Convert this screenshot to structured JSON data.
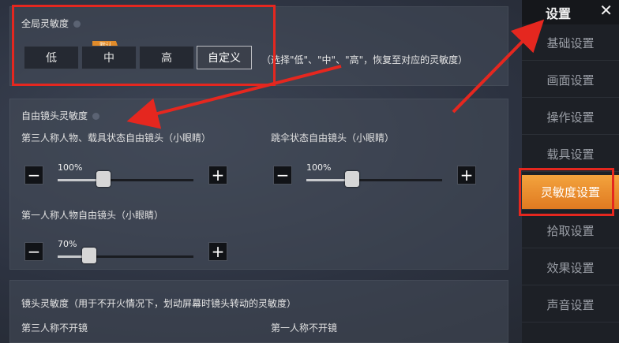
{
  "global_sensitivity": {
    "title": "全局灵敏度",
    "options": [
      "低",
      "中",
      "高",
      "自定义"
    ],
    "default_badge": "默认",
    "note": "（选择\"低\"、\"中\"、\"高\"，恢复至对应的灵敏度）"
  },
  "free_camera": {
    "title": "自由镜头灵敏度",
    "sliders": [
      {
        "label": "第三人称人物、载具状态自由镜头（小眼睛）",
        "value_text": "100%",
        "level": 0.34
      },
      {
        "label": "跳伞状态自由镜头（小眼睛）",
        "value_text": "100%",
        "level": 0.34
      },
      {
        "label": "第一人称人物自由镜头（小眼睛）",
        "value_text": "70%",
        "level": 0.23
      }
    ]
  },
  "camera_sensitivity": {
    "title": "镜头灵敏度（用于不开火情况下，划动屏幕时镜头转动的灵敏度）",
    "col1": "第三人称不开镜",
    "col2": "第一人称不开镜"
  },
  "sidebar": {
    "title": "设置",
    "close": "✕",
    "items": [
      "基础设置",
      "画面设置",
      "操作设置",
      "载具设置",
      "灵敏度设置",
      "拾取设置",
      "效果设置",
      "声音设置"
    ],
    "active_index": 4
  },
  "colors": {
    "accent": "#e8892a",
    "highlight_box": "#e5271f"
  }
}
